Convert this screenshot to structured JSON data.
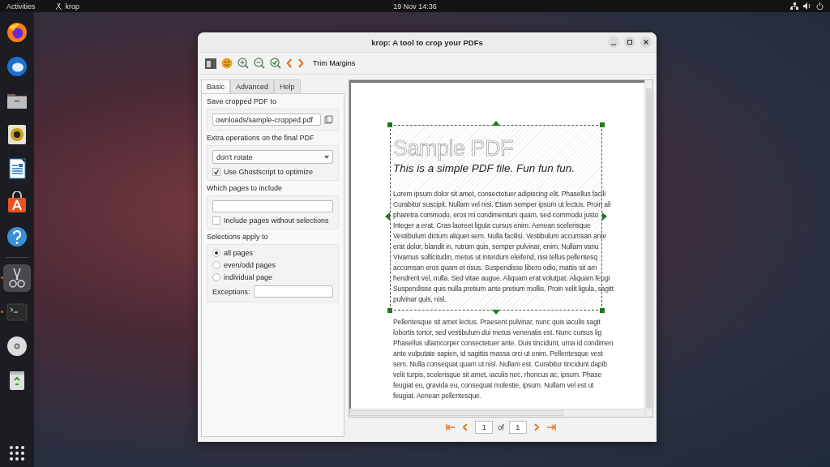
{
  "top_bar": {
    "activities": "Activities",
    "app_name": "krop",
    "clock": "19 Nov  14:36"
  },
  "dock": {
    "items": [
      {
        "kind": "browser",
        "running": false,
        "selected": false
      },
      {
        "kind": "mail",
        "running": false,
        "selected": false
      },
      {
        "kind": "folder",
        "running": false,
        "selected": false
      },
      {
        "kind": "speaker",
        "running": false,
        "selected": false
      },
      {
        "kind": "document",
        "running": false,
        "selected": false
      },
      {
        "kind": "store",
        "running": false,
        "selected": false
      },
      {
        "kind": "help",
        "running": false,
        "selected": false
      },
      {
        "kind": "scissors",
        "running": true,
        "selected": true
      },
      {
        "kind": "terminal",
        "running": true,
        "selected": false
      },
      {
        "kind": "disc",
        "running": false,
        "selected": false
      },
      {
        "kind": "trash",
        "running": false,
        "selected": false
      }
    ]
  },
  "window": {
    "title": "krop: A tool to crop your PDFs",
    "trim_label": "Trim Margins",
    "tabs": [
      {
        "label": "Basic",
        "selected": true
      },
      {
        "label": "Advanced",
        "selected": false
      },
      {
        "label": "Help",
        "selected": false
      }
    ],
    "save_section": {
      "heading": "Save cropped PDF to",
      "path": "ownloads/sample-cropped.pdf"
    },
    "extra_section": {
      "heading": "Extra operations on the final PDF",
      "rotate": "don't rotate",
      "ghostscript": {
        "label": "Use Ghostscript to optimize",
        "checked": true
      }
    },
    "pages_section": {
      "heading": "Which pages to include",
      "include_without": {
        "label": "Include pages without selections",
        "checked": false
      }
    },
    "selections_section": {
      "heading": "Selections apply to",
      "options": [
        {
          "label": "all pages",
          "selected": true
        },
        {
          "label": "even/odd pages",
          "selected": false
        },
        {
          "label": "individual page",
          "selected": false
        }
      ],
      "exceptions_label": "Exceptions:"
    },
    "document": {
      "title": "Sample PDF",
      "subtitle": "This is a simple PDF file. Fun fun fun.",
      "paragraphs": [
        [
          "Lorem ipsum dolor sit amet, consectetuer adipiscing elit. Phasellus facili",
          "Curabitur suscipit. Nullam vel nisi. Etiam semper ipsum ut lectus. Proin ali",
          "pharetra commodo, eros mi condimentum quam, sed commodo justo",
          "Integer a erat. Cras laoreet ligula cursus enim. Aenean scelerisque",
          "Vestibulum dictum aliquet sem. Nulla facilisi. Vestibulum accumsan ante",
          "erat dolor, blandit in, rutrum quis, semper pulvinar, enim. Nullam variu",
          "Vivamus sollicitudin, metus ut interdum eleifend, nisi tellus pellentesq",
          "accumsan eros quam et risus. Suspendisse libero odio, mattis sit am",
          "hendrerit vel, nulla. Sed vitae augue. Aliquam erat volutpat. Aliquam feugi",
          "Suspendisse quis nulla pretium ante pretium mollis. Proin velit ligula, sagitt",
          "pulvinar quis, nisl."
        ],
        [
          "Pellentesque sit amet lectus. Praesent pulvinar, nunc quis iaculis sagit",
          "lobortis tortor, sed vestibulum dui metus venenatis est. Nunc cursus lig",
          "Phasellus ullamcorper consectetuer ante. Duis tincidunt, urna id condimen",
          "ante vulputate sapien, id sagittis massa orci ut enim. Pellentesque vest",
          "sem. Nulla consequat quam ut nisl. Nullam est. Curabitur tincidunt dapib",
          "velit turpis, scelerisque sit amet, iaculis nec, rhoncus ac, ipsum. Phase",
          "feugiat eu, gravida eu, consequat molestie, ipsum. Nullam vel est ut",
          "feugiat. Aenean pellentesque."
        ]
      ]
    },
    "pager": {
      "page": "1",
      "of": "of",
      "total": "1"
    }
  }
}
